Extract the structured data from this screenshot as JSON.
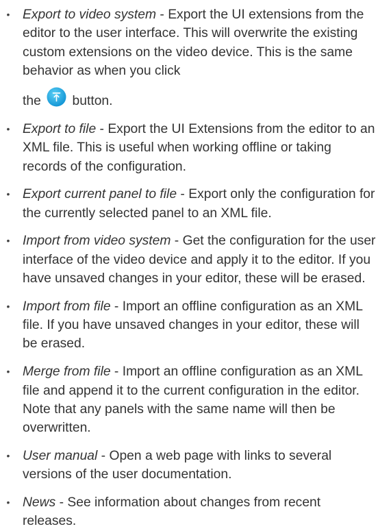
{
  "items": [
    {
      "term": "Export to video system",
      "sep": " - ",
      "desc": "Export the UI extensions from the editor to the user interface. This will overwrite the existing custom extensions on the video device. This is the same behavior as when you click",
      "tail_prefix": "the",
      "tail_suffix": "button.",
      "icon": "upload-icon",
      "icon_color": "#1ea6e0"
    },
    {
      "term": "Export to file",
      "sep": " - ",
      "desc": "Export the UI Extensions from the editor to an XML file. This is useful when working offline or taking records of the configuration."
    },
    {
      "term": "Export current panel to file",
      "sep": " - ",
      "desc": "Export only the configuration for the currently selected panel to an XML file."
    },
    {
      "term": "Import from video system",
      "sep": " - ",
      "desc": "Get the configuration for the user interface of the video device and apply it to the editor. If you have unsaved changes in your editor, these will be erased."
    },
    {
      "term": "Import from file",
      "sep": " - ",
      "desc": "Import an offline configuration as an XML file. If you have unsaved changes in your editor, these will be erased."
    },
    {
      "term": "Merge from file",
      "sep": " - ",
      "desc": "Import an offline configuration as an XML file and append it to the current configuration in the editor. Note that any panels with the same name will then be overwritten."
    },
    {
      "term": "User manual",
      "sep": " - ",
      "desc": "Open a web page with links to several versions of the user documentation."
    },
    {
      "term": "News",
      "sep": " - ",
      "desc": "See information about changes from recent releases."
    }
  ],
  "bullet": "•"
}
